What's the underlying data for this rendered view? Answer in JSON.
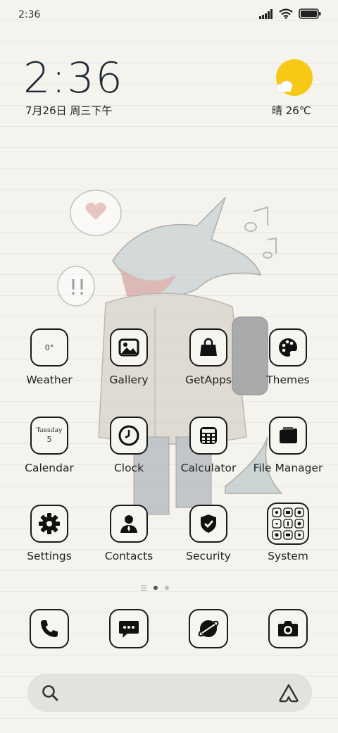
{
  "status": {
    "time": "2:36"
  },
  "clock": {
    "time": "2:36",
    "date": "7月26日 周三下午"
  },
  "weather": {
    "text": "晴 26℃"
  },
  "apps": [
    {
      "label": "Weather",
      "icon": "weather-icon",
      "sub": "0°"
    },
    {
      "label": "Gallery",
      "icon": "gallery-icon"
    },
    {
      "label": "GetApps",
      "icon": "shopping-bag-icon"
    },
    {
      "label": "Themes",
      "icon": "palette-icon"
    },
    {
      "label": "Calendar",
      "icon": "calendar-icon",
      "day": "Tuesday",
      "date": "5"
    },
    {
      "label": "Clock",
      "icon": "clock-icon"
    },
    {
      "label": "Calculator",
      "icon": "calculator-icon"
    },
    {
      "label": "File Manager",
      "icon": "folder-icon"
    },
    {
      "label": "Settings",
      "icon": "gear-icon"
    },
    {
      "label": "Contacts",
      "icon": "person-icon"
    },
    {
      "label": "Security",
      "icon": "shield-icon"
    },
    {
      "label": "System",
      "icon": "folder-grid-icon"
    }
  ],
  "dock": [
    {
      "icon": "phone-icon"
    },
    {
      "icon": "message-icon"
    },
    {
      "icon": "browser-icon"
    },
    {
      "icon": "camera-icon"
    }
  ],
  "colors": {
    "sun": "#f7c815",
    "background": "#f4f3ee",
    "icon_border": "#1a1a1a"
  }
}
